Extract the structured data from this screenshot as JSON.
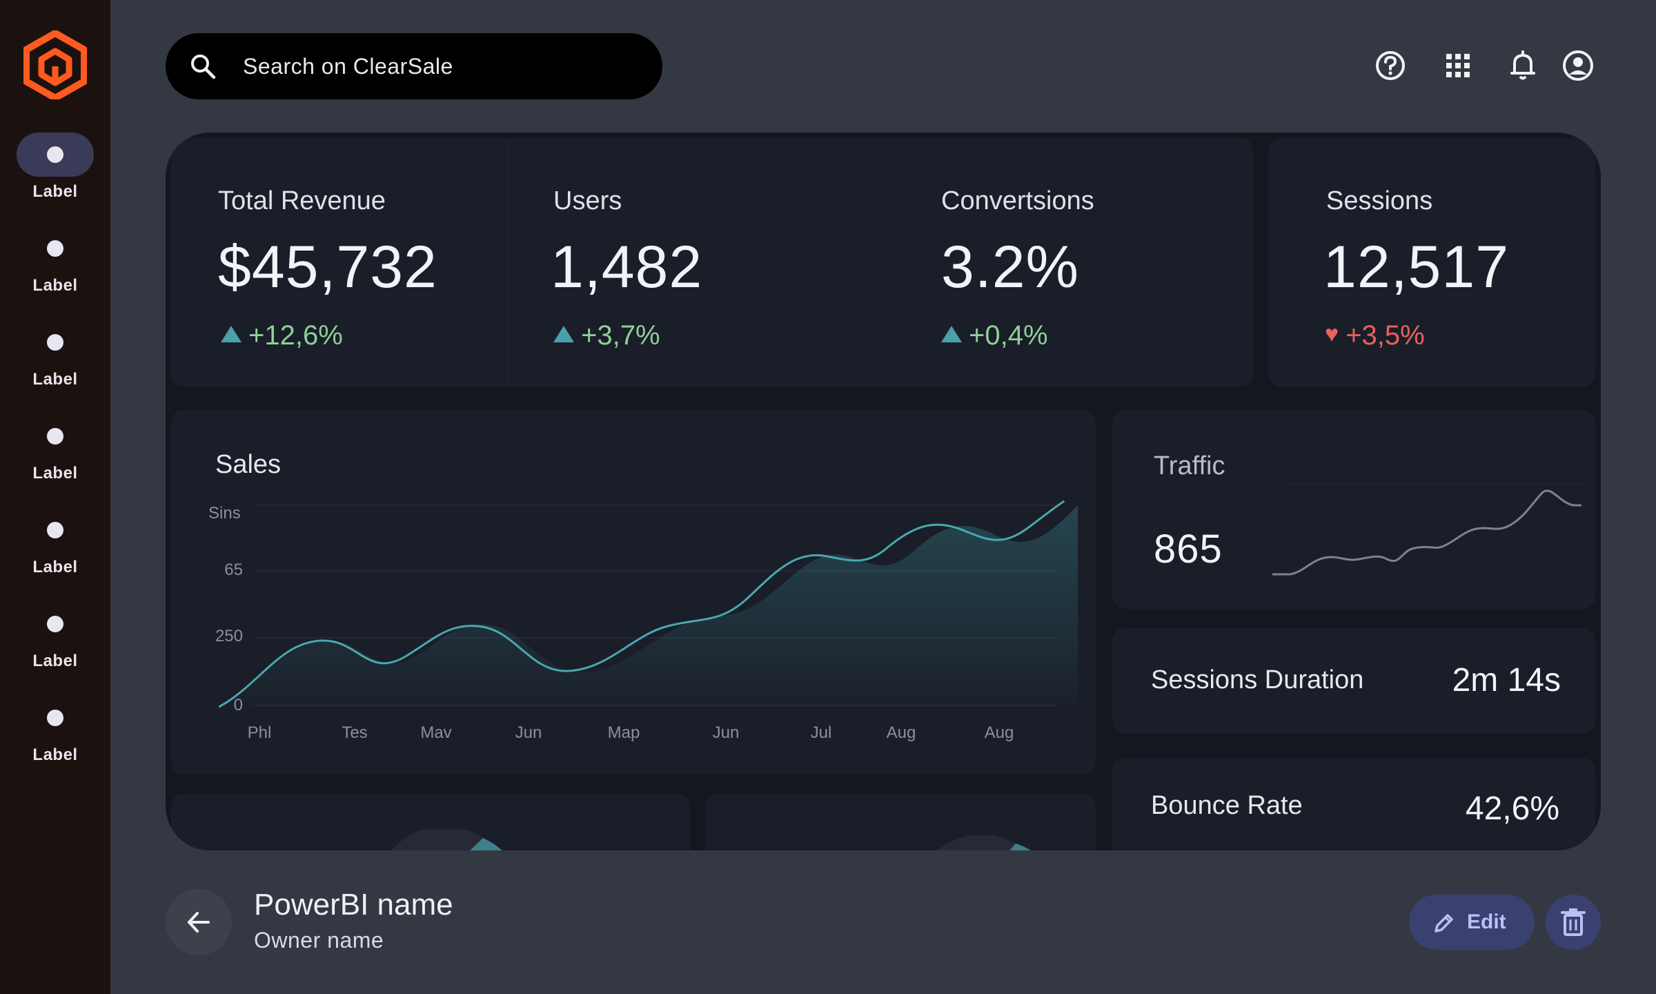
{
  "search": {
    "placeholder": "Search on ClearSale"
  },
  "sidebar": {
    "items": [
      {
        "label": "Label",
        "active": true
      },
      {
        "label": "Label",
        "active": false
      },
      {
        "label": "Label",
        "active": false
      },
      {
        "label": "Label",
        "active": false
      },
      {
        "label": "Label",
        "active": false
      },
      {
        "label": "Label",
        "active": false
      },
      {
        "label": "Label",
        "active": false
      }
    ]
  },
  "header_icons": [
    "help-icon",
    "apps-grid-icon",
    "notification-bell-icon",
    "account-icon"
  ],
  "kpis": [
    {
      "title": "Total Revenue",
      "value": "$45,732",
      "delta": "+12,6%",
      "trend": "up"
    },
    {
      "title": "Users",
      "value": "1,482",
      "delta": "+3,7%",
      "trend": "up"
    },
    {
      "title": "Convertsions",
      "value": "3.2%",
      "delta": "+0,4%",
      "trend": "up"
    },
    {
      "title": "Sessions",
      "value": "12,517",
      "delta": "+3,5%",
      "trend": "down"
    }
  ],
  "sales": {
    "title": "Sales",
    "y_ticks": [
      "Sins",
      "65",
      "250",
      "0"
    ],
    "x_ticks": [
      "Phl",
      "Tes",
      "Mav",
      "Jun",
      "Map",
      "Jun",
      "Jul",
      "Aug",
      "Aug"
    ]
  },
  "traffic": {
    "title": "Traffic",
    "value": "865"
  },
  "session_duration": {
    "label": "Sessions Duration",
    "value": "2m 14s"
  },
  "bounce_rate": {
    "label": "Bounce Rate",
    "value": "42,6%"
  },
  "footer": {
    "report_name": "PowerBI name",
    "owner_name": "Owner name",
    "edit_label": "Edit"
  },
  "colors": {
    "accent_teal": "#4aa0a8",
    "positive": "#8fcf9a",
    "negative": "#e8625a",
    "brand_orange": "#ff5a1f"
  }
}
